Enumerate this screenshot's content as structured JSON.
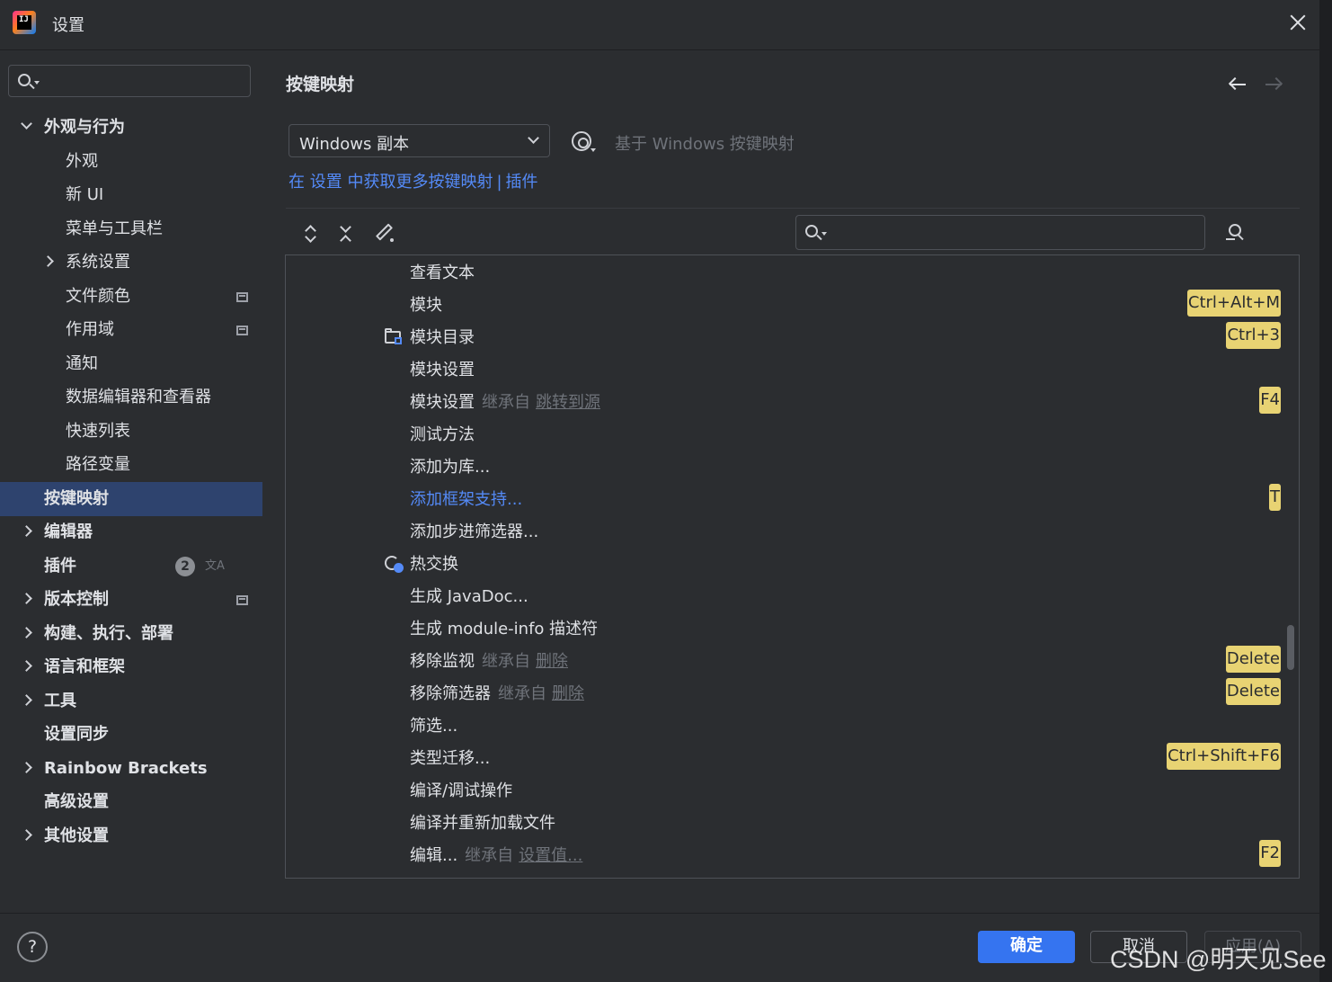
{
  "window": {
    "title": "设置"
  },
  "sidebar": {
    "items": [
      {
        "label": "外观与行为",
        "level": 0,
        "expanded": true,
        "bold": true
      },
      {
        "label": "外观",
        "level": 1
      },
      {
        "label": "新 UI",
        "level": 1
      },
      {
        "label": "菜单与工具栏",
        "level": 1
      },
      {
        "label": "系统设置",
        "level": 1,
        "collapsed": true
      },
      {
        "label": "文件颜色",
        "level": 1,
        "project_icon": true
      },
      {
        "label": "作用域",
        "level": 1,
        "project_icon": true
      },
      {
        "label": "通知",
        "level": 1
      },
      {
        "label": "数据编辑器和查看器",
        "level": 1
      },
      {
        "label": "快速列表",
        "level": 1
      },
      {
        "label": "路径变量",
        "level": 1
      },
      {
        "label": "按键映射",
        "level": 0,
        "bold": true,
        "selected": true
      },
      {
        "label": "编辑器",
        "level": 0,
        "collapsed": true,
        "bold": true
      },
      {
        "label": "插件",
        "level": 0,
        "bold": true,
        "badge": "2"
      },
      {
        "label": "版本控制",
        "level": 0,
        "collapsed": true,
        "bold": true,
        "project_icon": true
      },
      {
        "label": "构建、执行、部署",
        "level": 0,
        "collapsed": true,
        "bold": true
      },
      {
        "label": "语言和框架",
        "level": 0,
        "collapsed": true,
        "bold": true
      },
      {
        "label": "工具",
        "level": 0,
        "collapsed": true,
        "bold": true
      },
      {
        "label": "设置同步",
        "level": 0,
        "bold": true
      },
      {
        "label": "Rainbow Brackets",
        "level": 0,
        "collapsed": true,
        "bold": true
      },
      {
        "label": "高级设置",
        "level": 0,
        "bold": true
      },
      {
        "label": "其他设置",
        "level": 0,
        "collapsed": true,
        "bold": true
      }
    ],
    "translate_glyph": "文A"
  },
  "main": {
    "title": "按键映射",
    "keymap_value": "Windows 副本",
    "based_on": "基于 Windows 按键映射",
    "link_more": "在 设置 中获取更多按键映射",
    "link_sep": "|",
    "link_plugins": "插件"
  },
  "actions": [
    {
      "name": "查看文本"
    },
    {
      "name": "模块",
      "shortcut": "Ctrl+Alt+M"
    },
    {
      "name": "模块目录",
      "shortcut": "Ctrl+3",
      "icon": "folder-module-icon"
    },
    {
      "name": "模块设置"
    },
    {
      "name": "模块设置",
      "inherit": "继承自",
      "inherit_ref": "跳转到源",
      "shortcut": "F4"
    },
    {
      "name": "测试方法"
    },
    {
      "name": "添加为库..."
    },
    {
      "name": "添加框架支持...",
      "link": true,
      "shortcut": "T"
    },
    {
      "name": "添加步进筛选器..."
    },
    {
      "name": "热交换",
      "icon": "hotswap-icon"
    },
    {
      "name": "生成 JavaDoc..."
    },
    {
      "name": "生成 module-info 描述符"
    },
    {
      "name": "移除监视",
      "inherit": "继承自",
      "inherit_ref": "删除",
      "shortcut": "Delete"
    },
    {
      "name": "移除筛选器",
      "inherit": "继承自",
      "inherit_ref": "删除",
      "shortcut": "Delete"
    },
    {
      "name": "筛选..."
    },
    {
      "name": "类型迁移...",
      "shortcut": "Ctrl+Shift+F6"
    },
    {
      "name": "编译/调试操作"
    },
    {
      "name": "编译并重新加载文件"
    },
    {
      "name": "编辑...",
      "inherit": "继承自",
      "inherit_ref": "设置值...",
      "shortcut": "F2"
    }
  ],
  "footer": {
    "help": "?",
    "ok": "确定",
    "cancel": "取消",
    "apply": "应用(A)"
  },
  "watermark": "CSDN @明天见See",
  "colors": {
    "accent": "#3574f0",
    "link": "#548af7",
    "shortcut_bg": "#e8d373",
    "selected_bg": "#2e436e",
    "bg": "#2b2d30"
  }
}
